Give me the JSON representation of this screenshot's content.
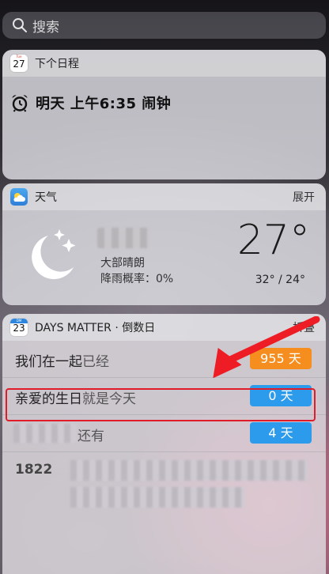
{
  "search": {
    "placeholder": "搜索"
  },
  "widgets": {
    "schedule": {
      "title": "下个日程",
      "icon_day": "27",
      "alarm_text": "明天 上午6:35 闹钟"
    },
    "weather": {
      "title": "天气",
      "action": "展开",
      "condition": "大部晴朗",
      "rain": "降雨概率：0%",
      "temperature": "27°",
      "hi_lo": "32° / 24°"
    },
    "days_matter": {
      "title": "DAYS MATTER · 倒数日",
      "action": "折叠",
      "icon_day": "23",
      "rows": [
        {
          "main": "我们在一起",
          "sub": "已经",
          "badge": "955 天",
          "color": "#f58e1e"
        },
        {
          "main": "亲爱的生日",
          "sub": "就是今天",
          "badge": "0 天",
          "color": "#2d9bec"
        },
        {
          "main": "",
          "sub": "还有",
          "badge": "4 天",
          "color": "#2d9bec"
        },
        {
          "main": "1822",
          "sub": "",
          "badge": "",
          "color": ""
        }
      ]
    }
  },
  "colors": {
    "highlight": "#e01c2a",
    "orange_badge": "#f58e1e",
    "blue_badge": "#2d9bec"
  },
  "icons": [
    "search-icon",
    "calendar-icon",
    "alarm-clock-icon",
    "weather-icon",
    "moon-stars-icon",
    "red-arrow-icon"
  ]
}
